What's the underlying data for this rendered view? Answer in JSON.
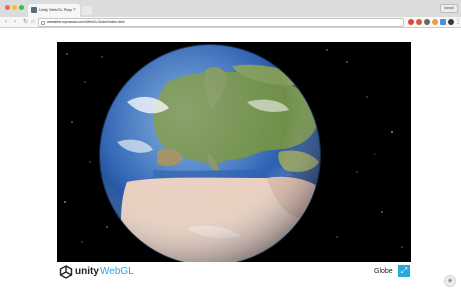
{
  "browser": {
    "tab_title": "Unity WebGL Player | Globe",
    "tab_close": "×",
    "url": "websitetr.mycamai.com/WebGLGlobe/index.html",
    "user_label": "Ismail",
    "nav": {
      "back": "‹",
      "forward": "›",
      "reload": "↻",
      "home": "⌂"
    },
    "menu": "⋮"
  },
  "player": {
    "brand_unity": "unity",
    "brand_webgl": "WebGL",
    "title": "Globe",
    "fullscreen_glyph": "⤢"
  },
  "colors": {
    "unity_accent": "#29a8e0",
    "canvas_bg": "#000000",
    "ocean": "#2a5fb0",
    "land_green": "#6f8f4a",
    "desert": "#e8cfc0"
  },
  "icons": {
    "page": "page-icon",
    "fullscreen": "fullscreen-icon",
    "corner": "settings-icon"
  }
}
